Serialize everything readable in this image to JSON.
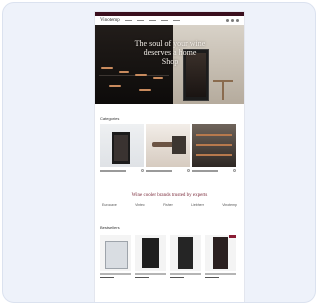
{
  "header": {
    "logo_text": "Vinotemp",
    "nav_links": [
      "",
      "",
      "",
      "",
      "",
      ""
    ]
  },
  "hero": {
    "title_lines": [
      "The soul of your wine",
      "deserves a home",
      "Shop"
    ]
  },
  "categories": {
    "section_label": "Categories",
    "items": [
      {
        "label": "",
        "colors": [
          "#e9ecef",
          "#1b1b1b"
        ]
      },
      {
        "label": "",
        "colors": [
          "#f1ede9",
          "#4a3b30"
        ]
      },
      {
        "label": "",
        "colors": [
          "#7a6d62",
          "#2e2824"
        ]
      },
      {
        "label": "",
        "colors": [
          "#1e1a18",
          "#b7794d"
        ]
      }
    ]
  },
  "brands": {
    "title": "Wine cooler brands trusted by experts",
    "items": [
      "Eurocave",
      "Vintec",
      "Fisher",
      "Liebherr",
      "Vinotemp"
    ]
  },
  "products": {
    "section_label": "Bestsellers",
    "items": [
      {
        "accent": "#d9dde2",
        "has_tag": false
      },
      {
        "accent": "#1f1f1f",
        "has_tag": false
      },
      {
        "accent": "#252525",
        "has_tag": false
      },
      {
        "accent": "#2a2020",
        "has_tag": true
      }
    ]
  },
  "colors": {
    "brand_bar": "#3a0f1e",
    "brand_accent": "#7a2a3a",
    "tag": "#8a1c34"
  }
}
